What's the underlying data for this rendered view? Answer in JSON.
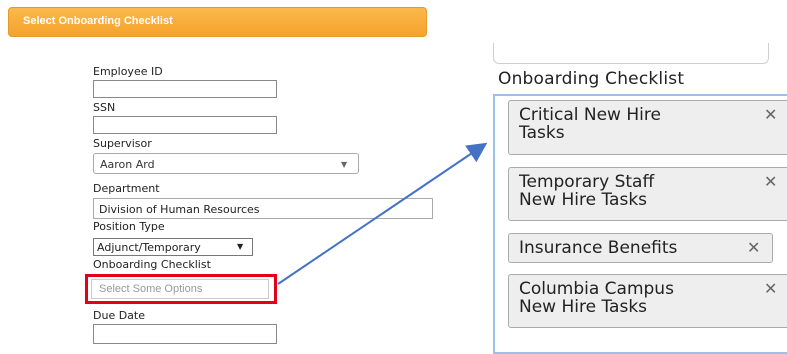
{
  "banner": {
    "title": "Select Onboarding Checklist"
  },
  "form": {
    "employee_id_label": "Employee ID",
    "ssn_label": "SSN",
    "supervisor_label": "Supervisor",
    "supervisor_value": "Aaron Ard",
    "department_label": "Department",
    "department_value": "Division of Human Resources",
    "position_type_label": "Position Type",
    "position_type_value": "Adjunct/Temporary",
    "onboarding_label": "Onboarding Checklist",
    "onboarding_placeholder": "Select Some Options",
    "due_date_label": "Due Date"
  },
  "zoom": {
    "title": "Onboarding Checklist",
    "chips": [
      {
        "line1": "Critical New Hire",
        "line2": "Tasks"
      },
      {
        "line1": "Temporary Staff",
        "line2": "New Hire Tasks"
      },
      {
        "line1": "Insurance Benefits",
        "line2": ""
      },
      {
        "line1": "Columbia Campus",
        "line2": "New Hire Tasks"
      }
    ],
    "remove_glyph": "✕"
  },
  "colors": {
    "banner": "#f5a32a",
    "highlight_box": "#e2001a",
    "arrow": "#4472c4",
    "panel_border": "#9cc0e8"
  },
  "icons": [
    "dropdown-caret-icon",
    "remove-icon",
    "arrow-annotation"
  ]
}
